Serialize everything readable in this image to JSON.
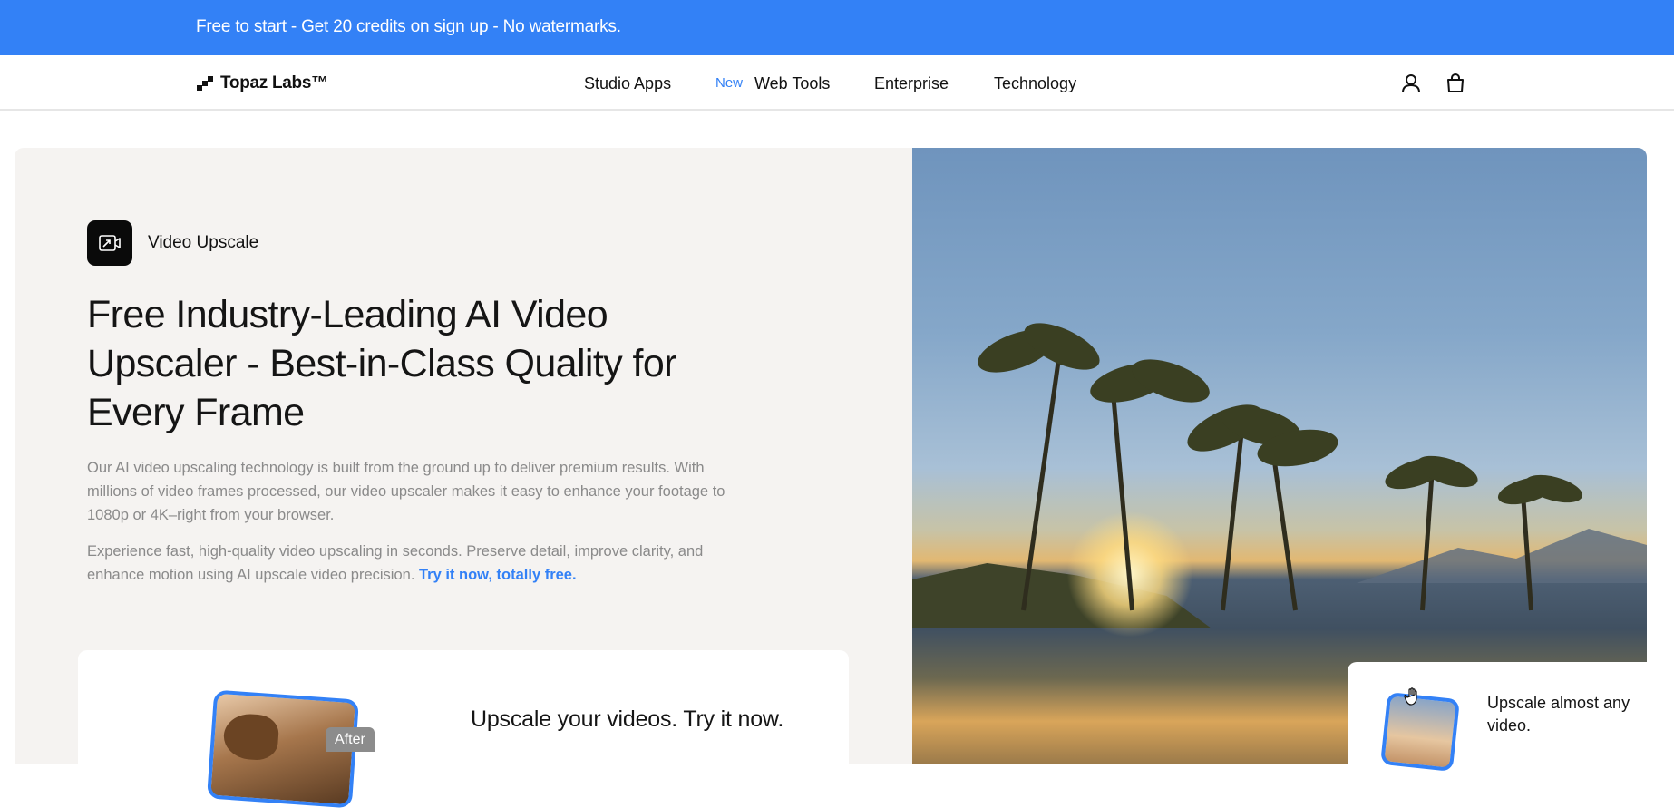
{
  "promo": {
    "text": "Free to start - Get 20 credits on sign up - No watermarks."
  },
  "nav": {
    "logo_text": "Topaz Labs™",
    "links": [
      {
        "label": "Studio Apps"
      },
      {
        "label": "Web Tools",
        "badge": "New"
      },
      {
        "label": "Enterprise"
      },
      {
        "label": "Technology"
      }
    ],
    "icons": [
      "account-icon",
      "cart-icon"
    ]
  },
  "hero": {
    "badge_label": "Video Upscale",
    "badge_icon": "video-upscale-icon",
    "headline": "Free Industry-Leading AI Video Upscaler - Best-in-Class Quality for Every Frame",
    "para1": "Our AI video upscaling technology is built from the ground up to deliver premium results. With millions of video frames processed, our video upscaler makes it easy to enhance your footage to 1080p or 4K–right from your browser.",
    "para2_text": "Experience fast, high-quality video upscaling in seconds. Preserve detail, improve clarity, and enhance motion using AI upscale video precision. ",
    "para2_link": "Try it now, totally free."
  },
  "try_card": {
    "tag": "After",
    "title": "Upscale your videos. Try it now."
  },
  "float_card": {
    "text": "Upscale almost any video."
  },
  "colors": {
    "accent": "#3381f6",
    "panel": "#f5f3f1",
    "text": "#151515",
    "muted": "#8a8a8a"
  }
}
